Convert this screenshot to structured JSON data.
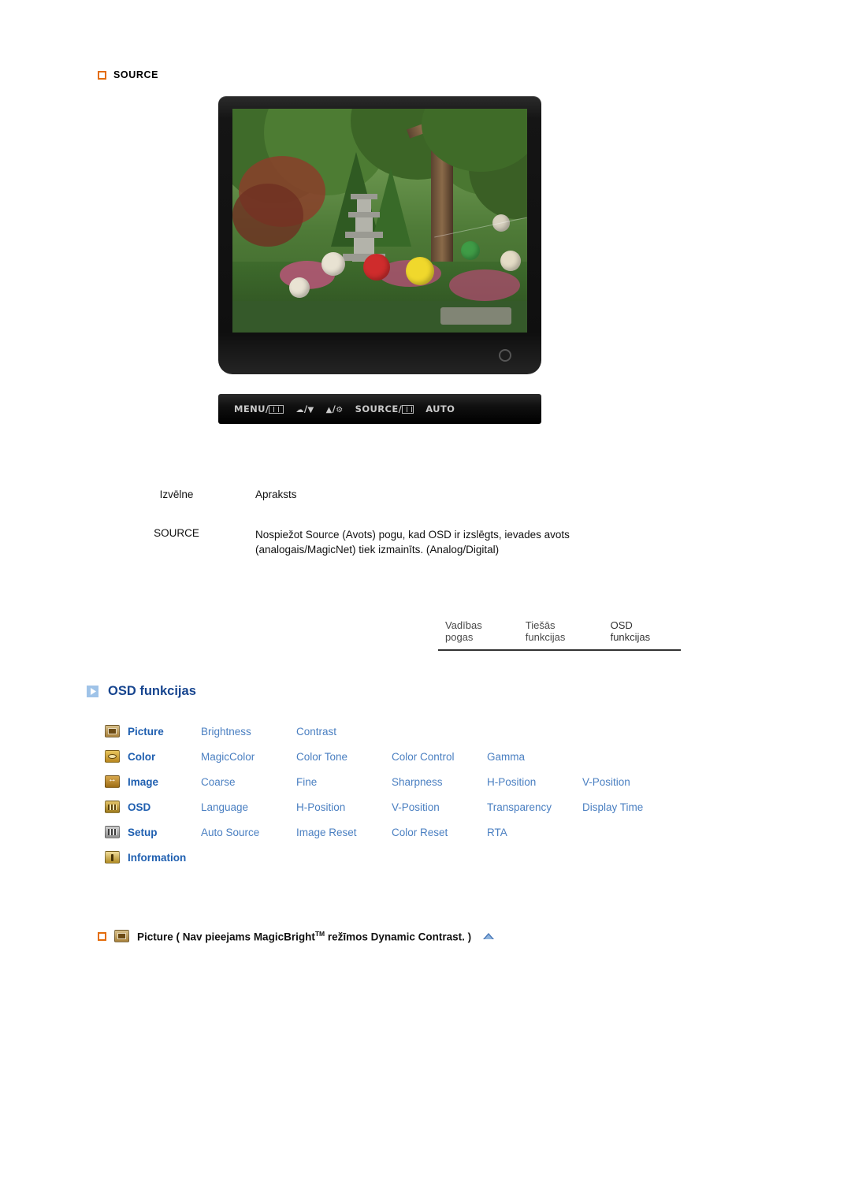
{
  "source_section": {
    "heading": "SOURCE",
    "bullet_icon": "orange-square-icon"
  },
  "monitor": {
    "buttons": [
      {
        "label": "MENU/",
        "icon": "menu-icon"
      },
      {
        "label": "/",
        "icon": "brightness-down-icon"
      },
      {
        "label": "/",
        "icon": "brightness-up-icon"
      },
      {
        "label": "SOURCE/",
        "icon": "source-icon"
      },
      {
        "label": "AUTO",
        "icon": ""
      }
    ],
    "power_led": "power-indicator"
  },
  "table": {
    "header": {
      "menu": "Izvēlne",
      "description": "Apraksts"
    },
    "rows": [
      {
        "menu": "SOURCE",
        "desc_line1": "Nospiežot Source (Avots) pogu, kad OSD ir izslēgts, ievades avots",
        "desc_line2": "(analogais/MagicNet) tiek izmainīts. (Analog/Digital)"
      }
    ]
  },
  "tabs": [
    {
      "label": "Vadības pogas"
    },
    {
      "label": "Tiešās funkcijas"
    },
    {
      "label": "OSD funkcijas"
    }
  ],
  "osd_section": {
    "heading": "OSD funkcijas",
    "rows": [
      {
        "icon": "picture-icon",
        "category": "Picture",
        "items": [
          "Brightness",
          "Contrast"
        ]
      },
      {
        "icon": "color-icon",
        "category": "Color",
        "items": [
          "MagicColor",
          "Color Tone",
          "Color Control",
          "Gamma"
        ]
      },
      {
        "icon": "image-icon",
        "category": "Image",
        "items": [
          "Coarse",
          "Fine",
          "Sharpness",
          "H-Position",
          "V-Position"
        ]
      },
      {
        "icon": "osd-icon",
        "category": "OSD",
        "items": [
          "Language",
          "H-Position",
          "V-Position",
          "Transparency",
          "Display Time"
        ]
      },
      {
        "icon": "setup-icon",
        "category": "Setup",
        "items": [
          "Auto Source",
          "Image Reset",
          "Color Reset",
          "RTA"
        ]
      },
      {
        "icon": "information-icon",
        "category": "Information",
        "items": []
      }
    ]
  },
  "picture_note": {
    "bullet_icon": "orange-square-icon",
    "menu_icon": "picture-icon",
    "text_before": "Picture ( Nav pieejams MagicBright",
    "superscript": "TM",
    "text_after": " režīmos Dynamic Contrast. )",
    "top_icon": "scroll-to-top-icon"
  },
  "colors": {
    "accent_orange": "#e36c0a",
    "heading_blue": "#17458f",
    "category_blue": "#1f5fb0",
    "link_blue": "#4a7fc1"
  }
}
